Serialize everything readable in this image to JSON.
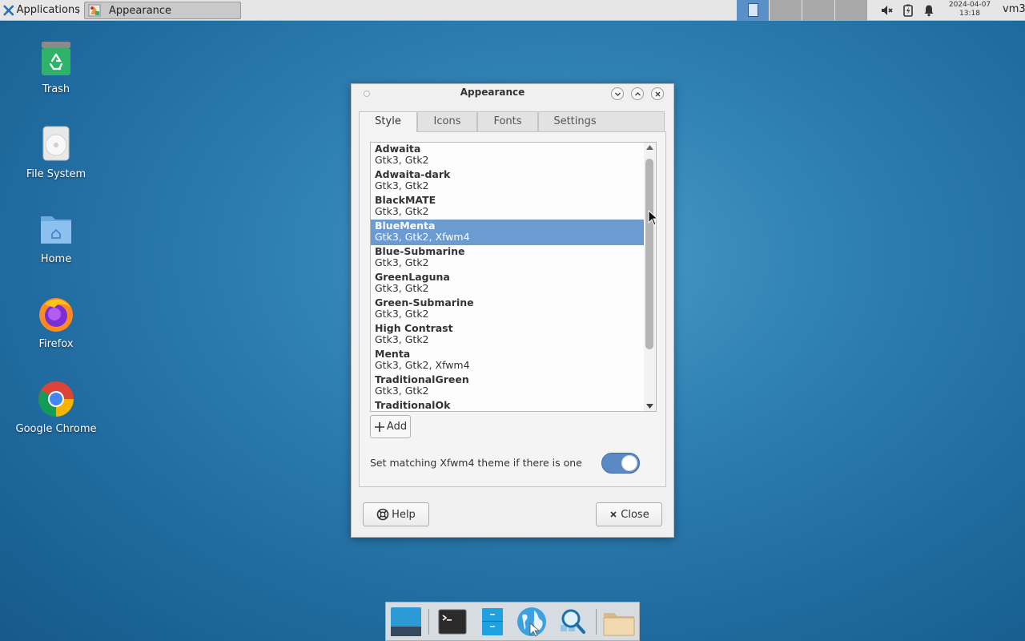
{
  "top_panel": {
    "applications_label": "Applications",
    "task_title": "Appearance",
    "clock_date": "2024-04-07",
    "clock_time": "13:18",
    "user": "vm3",
    "tray_icons": [
      "volume-muted-icon",
      "battery-icon",
      "notification-bell-icon"
    ]
  },
  "desktop": {
    "icons": [
      {
        "label": "Trash",
        "icon": "trash-icon"
      },
      {
        "label": "File System",
        "icon": "drive-icon"
      },
      {
        "label": "Home",
        "icon": "home-folder-icon"
      },
      {
        "label": "Firefox",
        "icon": "firefox-icon"
      },
      {
        "label": "Google Chrome",
        "icon": "chrome-icon"
      }
    ]
  },
  "window": {
    "title": "Appearance",
    "tabs": [
      "Style",
      "Icons",
      "Fonts",
      "Settings"
    ],
    "active_tab": "Style",
    "themes": [
      {
        "name": "Adwaita",
        "engines": "Gtk3, Gtk2"
      },
      {
        "name": "Adwaita-dark",
        "engines": "Gtk3, Gtk2"
      },
      {
        "name": "BlackMATE",
        "engines": "Gtk3, Gtk2"
      },
      {
        "name": "BlueMenta",
        "engines": "Gtk3, Gtk2, Xfwm4"
      },
      {
        "name": "Blue-Submarine",
        "engines": "Gtk3, Gtk2"
      },
      {
        "name": "GreenLaguna",
        "engines": "Gtk3, Gtk2"
      },
      {
        "name": "Green-Submarine",
        "engines": "Gtk3, Gtk2"
      },
      {
        "name": "High Contrast",
        "engines": "Gtk3, Gtk2"
      },
      {
        "name": "Menta",
        "engines": "Gtk3, Gtk2, Xfwm4"
      },
      {
        "name": "TraditionalGreen",
        "engines": "Gtk3, Gtk2"
      },
      {
        "name": "TraditionalOk",
        "engines": ""
      }
    ],
    "selected_theme": "BlueMenta",
    "add_label": "Add",
    "match_label": "Set matching Xfwm4 theme if there is one",
    "match_enabled": true,
    "help_label": "Help",
    "close_label": "Close"
  },
  "dock": {
    "items": [
      "show-desktop-icon",
      "terminal-icon",
      "file-manager-icon",
      "web-browser-icon",
      "app-finder-icon",
      "folder-icon"
    ]
  },
  "colors": {
    "selection": "#6b9bd1",
    "toggle_on": "#5b89c4",
    "desktop": "#2f80b3"
  }
}
